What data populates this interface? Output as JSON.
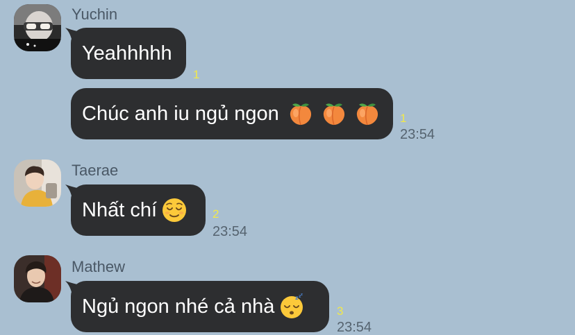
{
  "messages": [
    {
      "sender": "Yuchin",
      "avatar": "avatar-yuchin",
      "bubbles": [
        {
          "text": "Yeahhhhh",
          "emoji": [],
          "read_count": "1",
          "time": ""
        },
        {
          "text": "Chúc anh iu ngủ ngon",
          "emoji": [
            "peach-emoji",
            "peach-emoji",
            "peach-emoji"
          ],
          "read_count": "1",
          "time": "23:54"
        }
      ]
    },
    {
      "sender": "Taerae",
      "avatar": "avatar-taerae",
      "bubbles": [
        {
          "text": "Nhất chí",
          "emoji": [
            "relieved-face-emoji"
          ],
          "read_count": "2",
          "time": "23:54"
        }
      ]
    },
    {
      "sender": "Mathew",
      "avatar": "avatar-mathew",
      "bubbles": [
        {
          "text": "Ngủ ngon nhé cả nhà",
          "emoji": [
            "sleeping-face-emoji"
          ],
          "read_count": "3",
          "time": "23:54"
        }
      ]
    }
  ],
  "colors": {
    "background": "#a9bfd1",
    "bubble": "#2d2e30",
    "read_count": "#f1e84b"
  }
}
